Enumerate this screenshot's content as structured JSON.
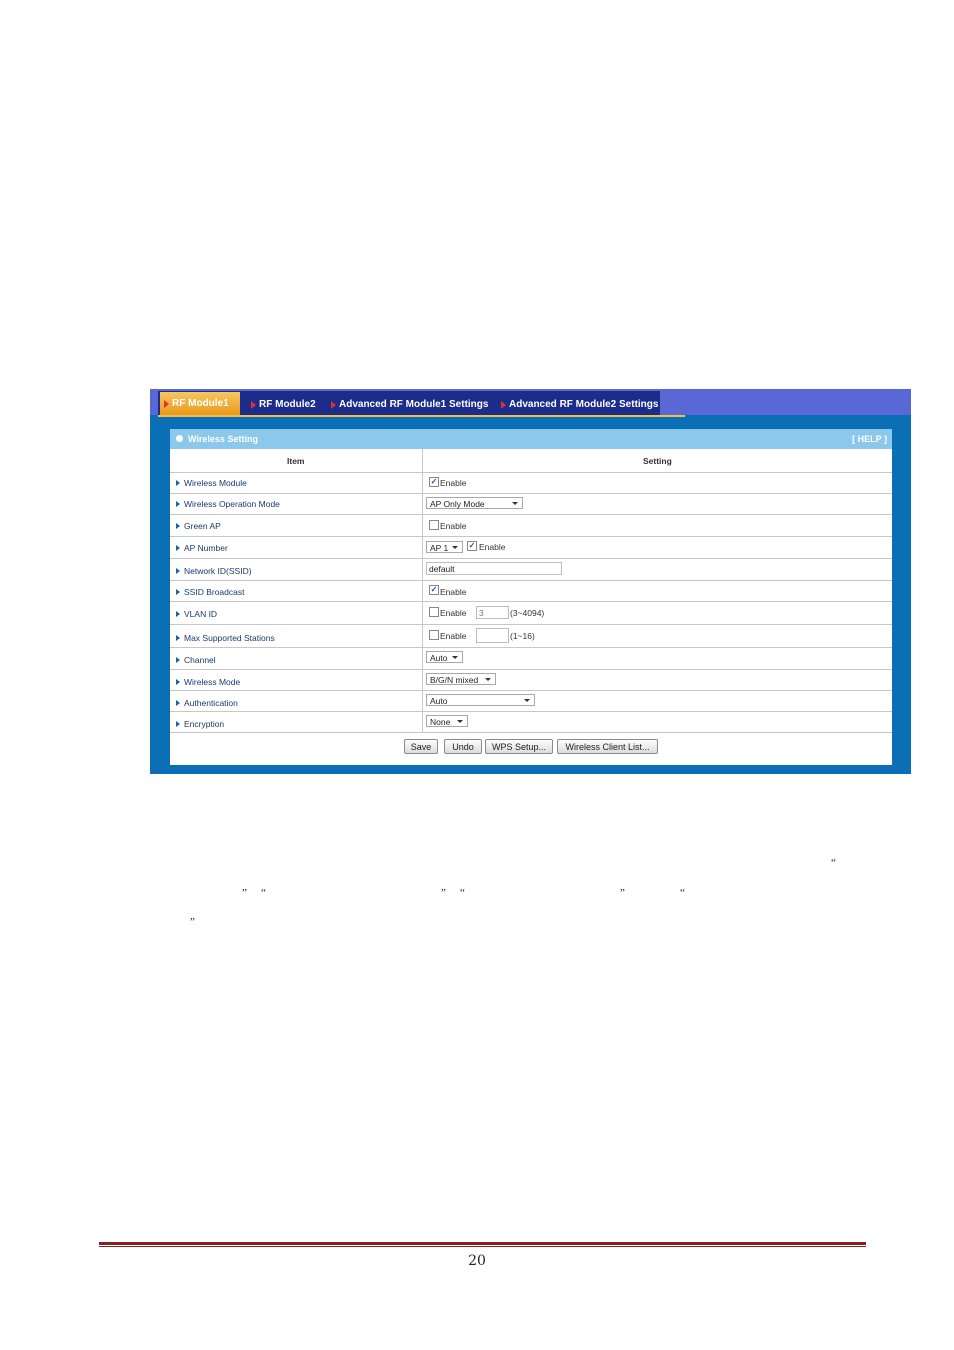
{
  "tabs": [
    {
      "label": "RF Module1",
      "active": true
    },
    {
      "label": "RF Module2",
      "active": false
    },
    {
      "label": "Advanced RF Module1 Settings",
      "active": false
    },
    {
      "label": "Advanced RF Module2 Settings",
      "active": false
    }
  ],
  "panel": {
    "title": "Wireless Setting",
    "help": "[ HELP ]"
  },
  "table": {
    "col_item": "Item",
    "col_setting": "Setting"
  },
  "rows": {
    "wireless_module": {
      "label": "Wireless Module",
      "cb_checked": true,
      "cb_label": "Enable"
    },
    "op_mode": {
      "label": "Wireless Operation Mode",
      "select": "AP Only Mode"
    },
    "green_ap": {
      "label": "Green AP",
      "cb_checked": false,
      "cb_label": "Enable"
    },
    "ap_number": {
      "label": "AP Number",
      "select": "AP 1",
      "cb_checked": true,
      "cb_label": "Enable"
    },
    "ssid": {
      "label": "Network ID(SSID)",
      "value": "default"
    },
    "ssid_broadcast": {
      "label": "SSID Broadcast",
      "cb_checked": true,
      "cb_label": "Enable"
    },
    "vlan": {
      "label": "VLAN ID",
      "cb_checked": false,
      "cb_label": "Enable",
      "value": "3",
      "range": "(3~4094)"
    },
    "max_stations": {
      "label": "Max Supported Stations",
      "cb_checked": false,
      "cb_label": "Enable",
      "value": "",
      "range": "(1~16)"
    },
    "channel": {
      "label": "Channel",
      "select": "Auto"
    },
    "wireless_mode": {
      "label": "Wireless Mode",
      "select": "B/G/N mixed"
    },
    "authentication": {
      "label": "Authentication",
      "select": "Auto"
    },
    "encryption": {
      "label": "Encryption",
      "select": "None"
    }
  },
  "buttons": {
    "save": "Save",
    "undo": "Undo",
    "wps": "WPS Setup...",
    "client_list": "Wireless Client List..."
  },
  "quotes": {
    "open": "“",
    "close": "”"
  },
  "page_number": "20"
}
